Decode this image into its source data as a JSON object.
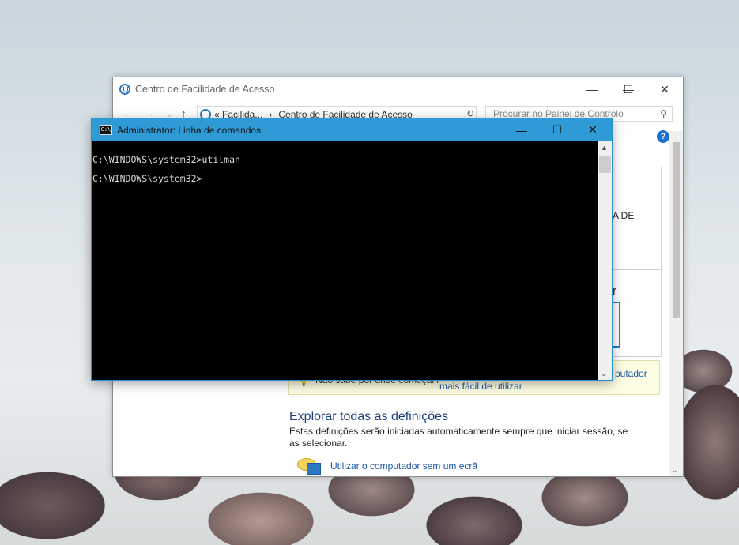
{
  "control_panel": {
    "title": "Centro de Facilidade de Acesso",
    "address_prefix": "«  Facilida...",
    "address_arrow": "›",
    "address_current": "Centro de Facilidade de Acesso",
    "search_placeholder": "Procurar no Painel de Controlo",
    "help": "?",
    "fragment_right_1": "A DE",
    "fragment_right_2": "r",
    "tip_question": "Não sabe por onde começar?",
    "tip_link_right": "putador",
    "tip_link_2": "mais fácil de utilizar",
    "explore_heading": "Explorar todas as definições",
    "explore_text": "Estas definições serão iniciadas automaticamente sempre que iniciar sessão, se as selecionar.",
    "option_1": "Utilizar o computador sem um ecrã"
  },
  "cmd": {
    "title": "Administrator: Linha de comandos",
    "icon_text": "C:\\",
    "lines": [
      "C:\\WINDOWS\\system32>utilman",
      "C:\\WINDOWS\\system32>"
    ]
  },
  "glyphs": {
    "minimize": "—",
    "maximize": "☐",
    "close": "✕",
    "back": "←",
    "forward": "→",
    "up": "↑",
    "down_small": "⌄",
    "refresh": "↻",
    "search": "⚲",
    "scroll_up": "▲",
    "scroll_down": "▼"
  },
  "colors": {
    "cmd_title_bar": "#2e9bd6",
    "link": "#1d56a8",
    "tip_background": "#fdfde3"
  }
}
